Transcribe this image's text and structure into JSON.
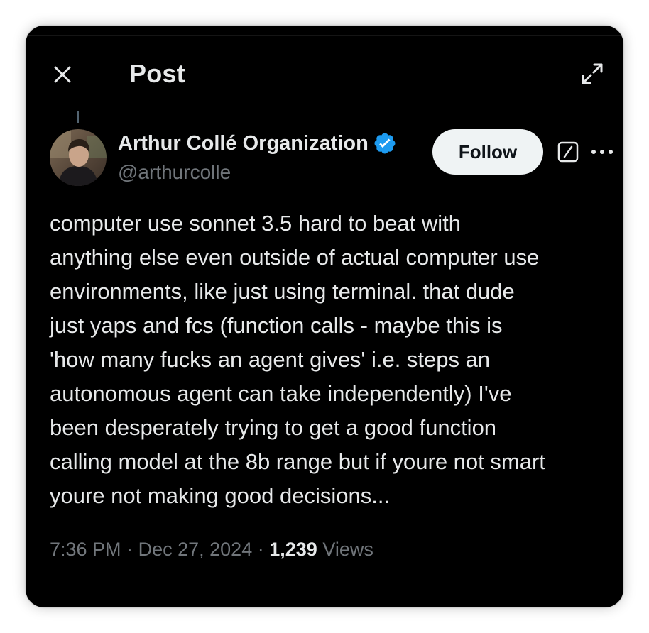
{
  "header": {
    "title": "Post",
    "close_icon": "close-icon",
    "expand_icon": "expand-icon"
  },
  "author": {
    "name": "Arthur Collé Organization",
    "handle": "@arthurcolle",
    "verified": true,
    "verified_color": "#1d9bf0"
  },
  "actions": {
    "follow_label": "Follow",
    "grok_icon": "grok-icon",
    "more_icon": "more-icon"
  },
  "post": {
    "text": "computer use sonnet 3.5 hard to beat with\nanything else even outside of actual computer use\nenvironments, like just using terminal. that dude\njust yaps and fcs (function calls - maybe this is\n'how many fucks an agent gives' i.e. steps an\nautonomous agent can take independently) I've\nbeen desperately trying to get a good function\ncalling model at the 8b range but if youre not smart\nyoure not making good decisions..."
  },
  "meta": {
    "time": "7:36 PM",
    "separator": "·",
    "date": "Dec 27, 2024",
    "views_count": "1,239",
    "views_label": "Views"
  },
  "colors": {
    "background": "#000000",
    "text": "#e7e9ea",
    "muted": "#71767b",
    "button_bg": "#eff3f4"
  }
}
